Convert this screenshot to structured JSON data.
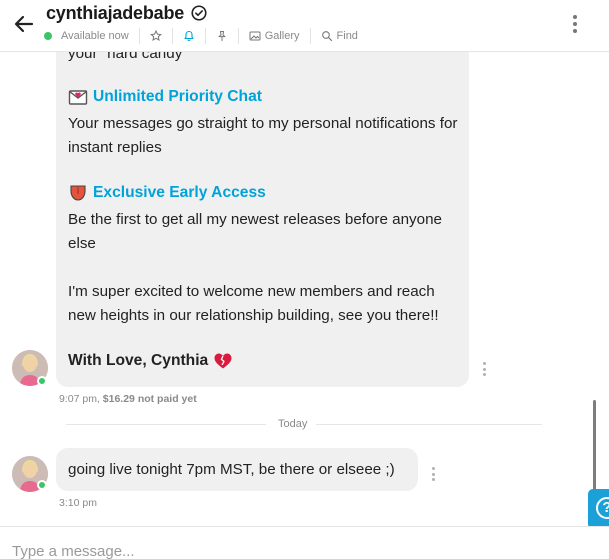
{
  "header": {
    "back_icon": "arrow-left-icon",
    "name": "cynthiajadebabe",
    "verified_icon": "verified-check-icon",
    "status": "Available now",
    "status_color": "#3cc46a",
    "actions": [
      {
        "icon": "star-icon",
        "label": ""
      },
      {
        "icon": "bell-icon",
        "label": "",
        "active_color": "#00a3d9"
      },
      {
        "icon": "pin-icon",
        "label": ""
      },
      {
        "icon": "image-icon",
        "label": "Gallery"
      },
      {
        "icon": "search-icon",
        "label": "Find"
      }
    ],
    "more_icon": "more-vertical-icon"
  },
  "messages": [
    {
      "sender": "cynthiajadebabe",
      "partial_top_line": "your \"hard candy\"",
      "sections": [
        {
          "icon": "love-letter-emoji",
          "title": "Unlimited Priority Chat",
          "body": "Your messages go straight to my personal notifications for instant replies"
        },
        {
          "icon": "tongue-emoji",
          "title": "Exclusive Early Access",
          "body": "Be the first to get all my newest releases before anyone else"
        }
      ],
      "paragraph": "I'm super excited to welcome new members and reach new heights in our relationship building, see you there!!",
      "signoff": "With Love, Cynthia",
      "signoff_icon": "broken-heart-emoji",
      "time": "9:07 pm,",
      "price": "$16.29 not paid yet"
    },
    {
      "sender": "cynthiajadebabe",
      "text": "going live tonight 7pm MST, be there or elseee ;)",
      "time": "3:10 pm"
    }
  ],
  "divider_label": "Today",
  "composer": {
    "placeholder": "Type a message..."
  },
  "help_button": {
    "icon": "help-circle-icon",
    "label": "?",
    "color": "#1ba0d8"
  },
  "accent_color": "#00a3d9"
}
